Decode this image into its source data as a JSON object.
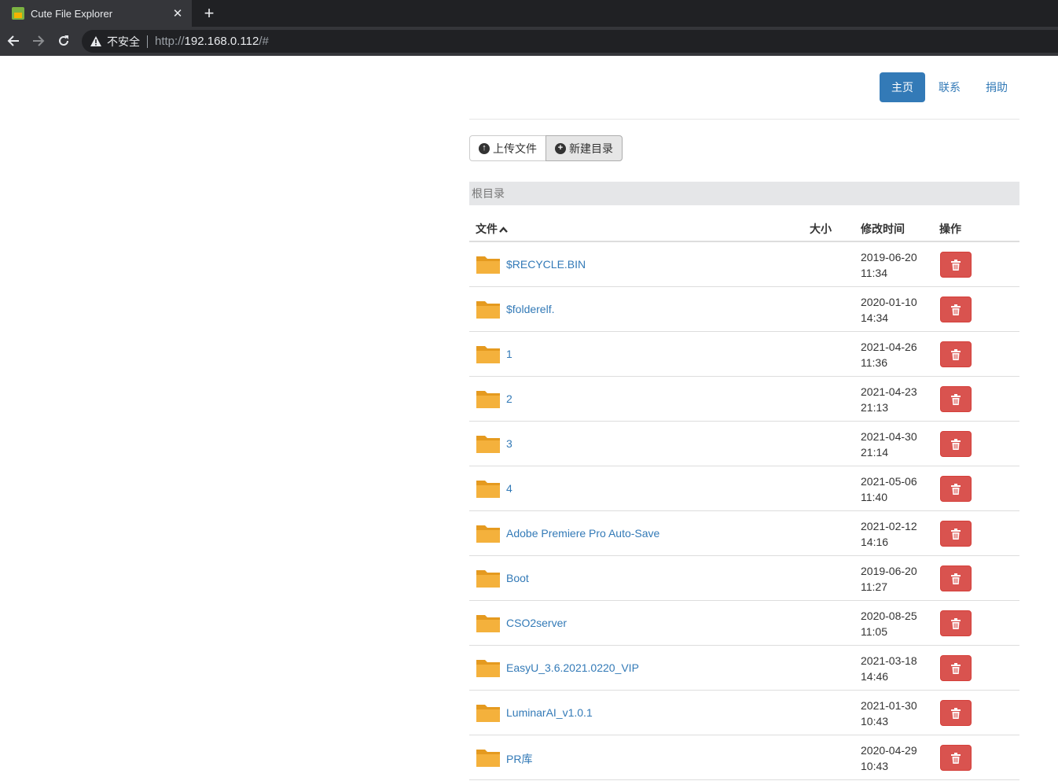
{
  "browser": {
    "tab_title": "Cute File Explorer",
    "tab_close": "✕",
    "new_tab": "+",
    "security_label": "不安全",
    "url_scheme": "http://",
    "url_host": "192.168.0.112",
    "url_rest": "/#"
  },
  "nav": {
    "items": [
      {
        "label": "主页",
        "active": true
      },
      {
        "label": "联系",
        "active": false
      },
      {
        "label": "捐助",
        "active": false
      }
    ]
  },
  "actions": {
    "upload_label": "上传文件",
    "upload_icon": "↑",
    "newdir_label": "新建目录",
    "newdir_icon": "+"
  },
  "breadcrumb": "根目录",
  "table": {
    "col_file": "文件",
    "col_file_sort": "^",
    "col_size": "大小",
    "col_mtime": "修改时间",
    "col_ops": "操作"
  },
  "files": [
    {
      "name": "$RECYCLE.BIN",
      "date": "2019-06-20",
      "time": "11:34"
    },
    {
      "name": "$folderelf.",
      "date": "2020-01-10",
      "time": "14:34"
    },
    {
      "name": "1",
      "date": "2021-04-26",
      "time": "11:36"
    },
    {
      "name": "2",
      "date": "2021-04-23",
      "time": "21:13"
    },
    {
      "name": "3",
      "date": "2021-04-30",
      "time": "21:14"
    },
    {
      "name": "4",
      "date": "2021-05-06",
      "time": "11:40"
    },
    {
      "name": "Adobe Premiere Pro Auto-Save",
      "date": "2021-02-12",
      "time": "14:16"
    },
    {
      "name": "Boot",
      "date": "2019-06-20",
      "time": "11:27"
    },
    {
      "name": "CSO2server",
      "date": "2020-08-25",
      "time": "11:05"
    },
    {
      "name": "EasyU_3.6.2021.0220_VIP",
      "date": "2021-03-18",
      "time": "14:46"
    },
    {
      "name": "LuminarAI_v1.0.1",
      "date": "2021-01-30",
      "time": "10:43"
    },
    {
      "name": "PR库",
      "date": "2020-04-29",
      "time": "10:43"
    }
  ],
  "colors": {
    "primary": "#337ab7",
    "danger": "#d9534f",
    "folder": "#f0ad2e"
  }
}
